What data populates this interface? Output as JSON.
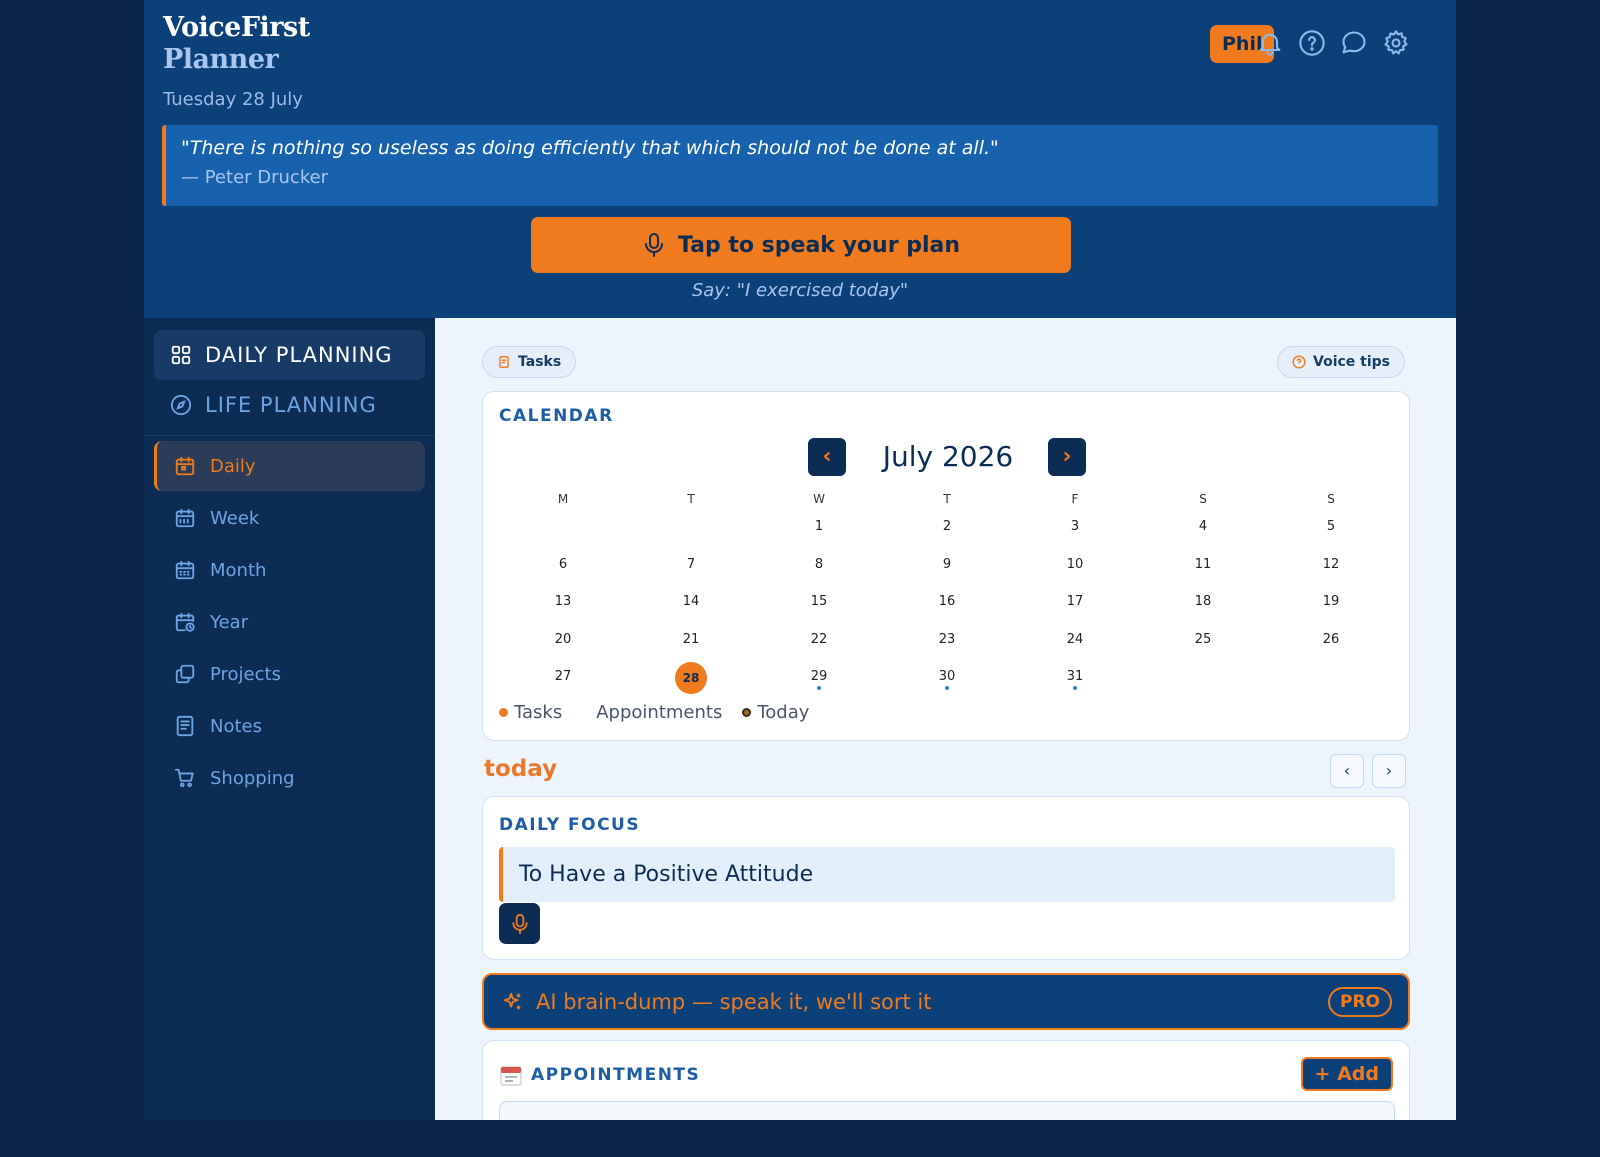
{
  "header": {
    "brand_line1": "VoiceFirst",
    "brand_line2": "Planner",
    "date": "Tuesday 28 July",
    "quote_text": "\"There is nothing so useless as doing efficiently that which should not be done at all.\"",
    "quote_author": "— Peter Drucker",
    "speak_button": "Tap to speak your plan",
    "speak_hint": "Say: \"I exercised today\"",
    "user_name": "Phil",
    "icons": [
      "bell-icon",
      "help-icon",
      "chat-icon",
      "settings-icon"
    ]
  },
  "sidebar": {
    "modes": [
      {
        "label": "DAILY PLANNING",
        "icon": "grid-icon",
        "active": true
      },
      {
        "label": "LIFE PLANNING",
        "icon": "compass-icon",
        "active": false
      }
    ],
    "items": [
      {
        "label": "Daily",
        "icon": "calendar-day-icon",
        "active": true
      },
      {
        "label": "Week",
        "icon": "calendar-week-icon"
      },
      {
        "label": "Month",
        "icon": "calendar-month-icon"
      },
      {
        "label": "Year",
        "icon": "calendar-clock-icon"
      },
      {
        "label": "Projects",
        "icon": "projects-icon"
      },
      {
        "label": "Notes",
        "icon": "notes-icon"
      },
      {
        "label": "Shopping",
        "icon": "cart-icon"
      }
    ]
  },
  "main": {
    "tasks_pill": "Tasks",
    "voice_tips_pill": "Voice tips",
    "calendar": {
      "title": "CALENDAR",
      "month_label": "July 2026",
      "prev": "‹",
      "next": "›",
      "weekdays": [
        "M",
        "T",
        "W",
        "T",
        "F",
        "S",
        "S"
      ],
      "weeks": [
        [
          "",
          "",
          "1",
          "2",
          "3",
          "4",
          "5"
        ],
        [
          "6",
          "7",
          "8",
          "9",
          "10",
          "11",
          "12"
        ],
        [
          "13",
          "14",
          "15",
          "16",
          "17",
          "18",
          "19"
        ],
        [
          "20",
          "21",
          "22",
          "23",
          "24",
          "25",
          "26"
        ],
        [
          "27",
          "28",
          "29",
          "30",
          "31",
          "",
          ""
        ]
      ],
      "today": "28",
      "appointment_days": [
        "29",
        "30",
        "31"
      ],
      "legend": {
        "tasks": "Tasks",
        "appointments": "Appointments",
        "today": "Today"
      }
    },
    "today_label": "today",
    "day_prev": "‹",
    "day_next": "›",
    "daily_focus": {
      "title": "DAILY FOCUS",
      "text": "To Have a Positive Attitude"
    },
    "ai_bar": {
      "label": "AI brain-dump — speak it, we'll sort it",
      "badge": "PRO"
    },
    "appointments": {
      "title": "APPOINTMENTS",
      "add_label": "+ Add"
    }
  },
  "colors": {
    "accent": "#f07a1e",
    "navy": "#0c2c54",
    "header_blue": "#0c4079"
  }
}
